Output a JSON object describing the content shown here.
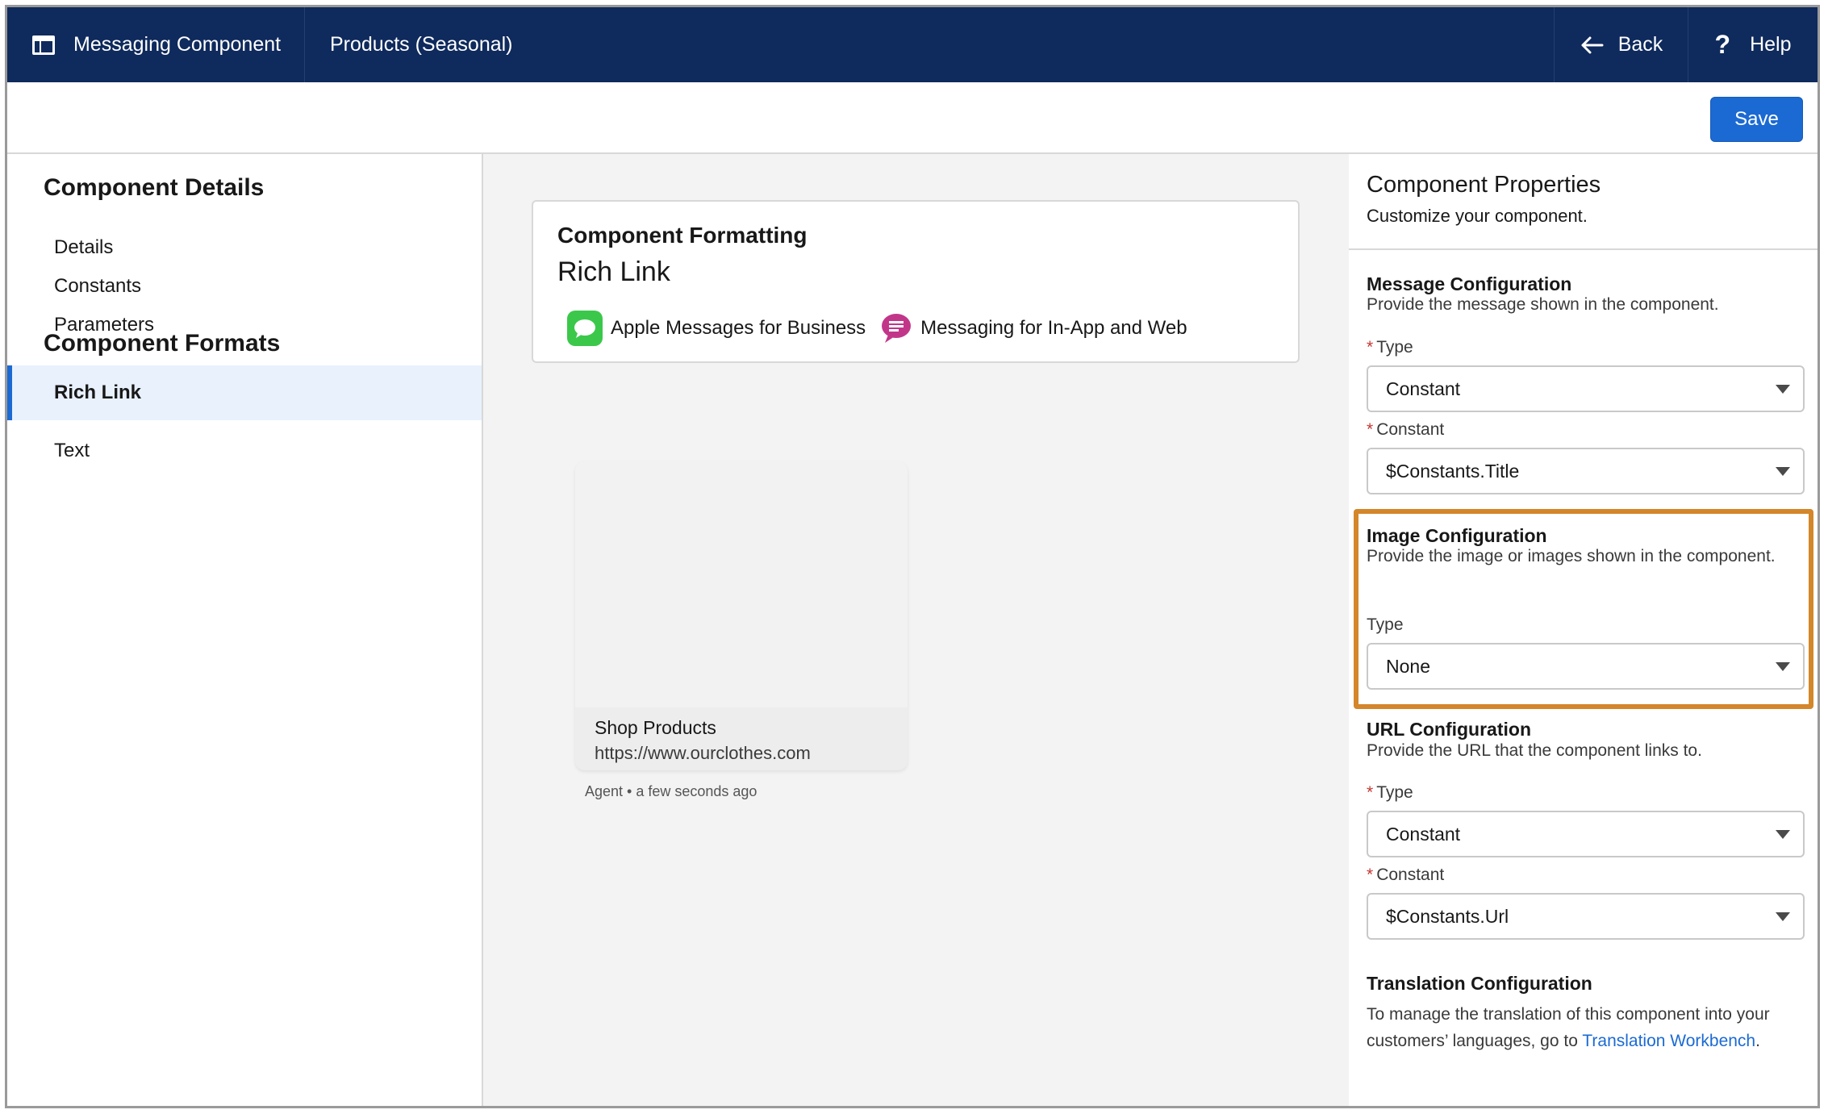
{
  "header": {
    "app_title": "Messaging Component",
    "page_title": "Products (Seasonal)",
    "back_label": "Back",
    "help_label": "Help"
  },
  "toolbar": {
    "save_label": "Save"
  },
  "sidebar": {
    "details_heading": "Component Details",
    "details_items": [
      "Details",
      "Constants",
      "Parameters"
    ],
    "formats_heading": "Component Formats",
    "format_items": [
      {
        "label": "Rich Link",
        "active": true
      },
      {
        "label": "Text",
        "active": false
      }
    ]
  },
  "canvas": {
    "card_title": "Component Formatting",
    "card_subtitle": "Rich Link",
    "channels": [
      "Apple Messages for Business",
      "Messaging for In-App and Web"
    ],
    "preview": {
      "title": "Shop Products",
      "url": "https://www.ourclothes.com",
      "meta": "Agent • a few seconds ago"
    }
  },
  "properties": {
    "title": "Component Properties",
    "subtitle": "Customize your component.",
    "message": {
      "title": "Message Configuration",
      "desc": "Provide the message shown in the component.",
      "type_label": "Type",
      "type_value": "Constant",
      "constant_label": "Constant",
      "constant_value": "$Constants.Title"
    },
    "image": {
      "title": "Image Configuration",
      "desc": "Provide the image or images shown in the component.",
      "type_label": "Type",
      "type_value": "None"
    },
    "url": {
      "title": "URL Configuration",
      "desc": "Provide the URL that the component links to.",
      "type_label": "Type",
      "type_value": "Constant",
      "constant_label": "Constant",
      "constant_value": "$Constants.Url"
    },
    "translation": {
      "title": "Translation Configuration",
      "desc": "To manage the translation of this component into your customers’ languages, go to",
      "link": "Translation Workbench",
      "end": "."
    }
  },
  "colors": {
    "header_bg": "#0f2a5c",
    "accent": "#1b6ad3",
    "highlight": "#d4862a",
    "required": "#c23934"
  }
}
